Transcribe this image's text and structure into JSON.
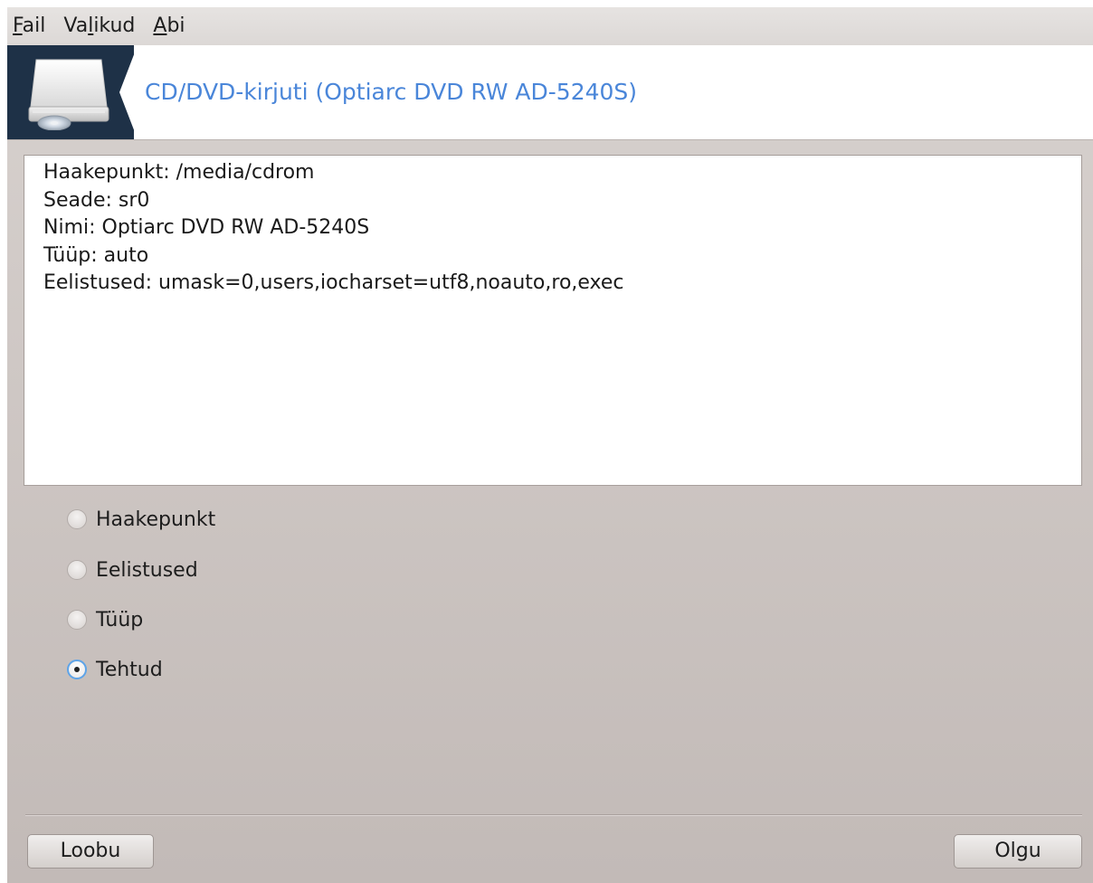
{
  "menubar": {
    "items": [
      {
        "mnemonic": "F",
        "rest": "ail"
      },
      {
        "before": "Va",
        "mnemonic": "l",
        "after": "ikud"
      },
      {
        "mnemonic": "A",
        "rest": "bi"
      }
    ]
  },
  "banner": {
    "icon": "optical-drive-icon",
    "title": "CD/DVD-kirjuti (Optiarc DVD RW AD-5240S)",
    "title_color": "#4a86d9",
    "icon_background": "#1e3147"
  },
  "info": {
    "lines": [
      "Haakepunkt: /media/cdrom",
      "Seade: sr0",
      "Nimi: Optiarc DVD RW AD-5240S",
      "Tüüp: auto",
      "Eelistused: umask=0,users,iocharset=utf8,noauto,ro,exec"
    ]
  },
  "options": {
    "items": [
      {
        "label": "Haakepunkt",
        "checked": false
      },
      {
        "label": "Eelistused",
        "checked": false
      },
      {
        "label": "Tüüp",
        "checked": false
      },
      {
        "label": "Tehtud",
        "checked": true
      }
    ]
  },
  "buttons": {
    "cancel_label": "Loobu",
    "ok_label": "Olgu"
  }
}
